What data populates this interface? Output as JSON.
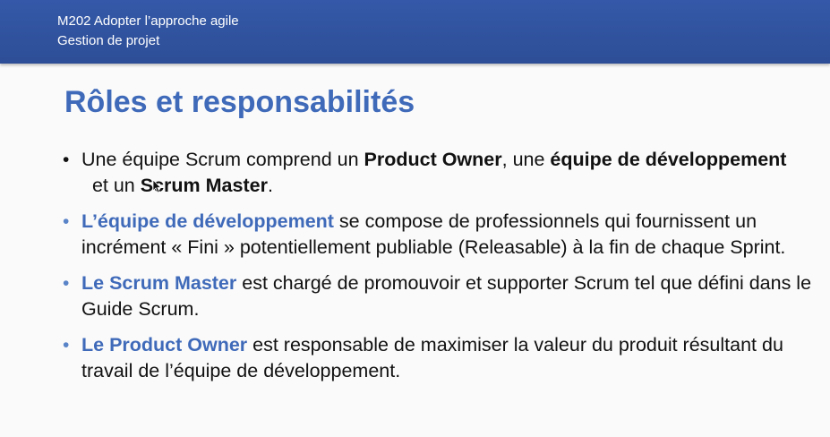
{
  "header": {
    "line1": "M202 Adopter l’approche agile",
    "line2": "Gestion de projet"
  },
  "slide": {
    "title": "Rôles et responsabilités",
    "bullets": [
      {
        "t1": "Une équipe Scrum comprend un ",
        "b1": "Product Owner",
        "t2": ", une ",
        "b2": "équipe de développement",
        "t3": "  et un ",
        "b3": "Scrum Master",
        "t4": "."
      },
      {
        "highlight": "L’équipe de développement",
        "text": " se compose de professionnels qui fournissent un incrément « Fini » potentiellement publiable (Releasable) à la fin de chaque Sprint."
      },
      {
        "highlight": "Le Scrum Master",
        "text": " est chargé de promouvoir et supporter Scrum tel que défini dans le Guide Scrum."
      },
      {
        "highlight": "Le Product Owner",
        "text": " est responsable de maximiser la valeur du produit résultant du travail de l’équipe de développement."
      }
    ]
  },
  "colors": {
    "header_bg": "#3559a8",
    "title": "#3f6ab9",
    "highlight": "#3f6ab9",
    "bullet_blue": "#5a84c8"
  },
  "icons": {
    "bullet": "bullet-dot",
    "cursor": "mouse-pointer-icon"
  }
}
